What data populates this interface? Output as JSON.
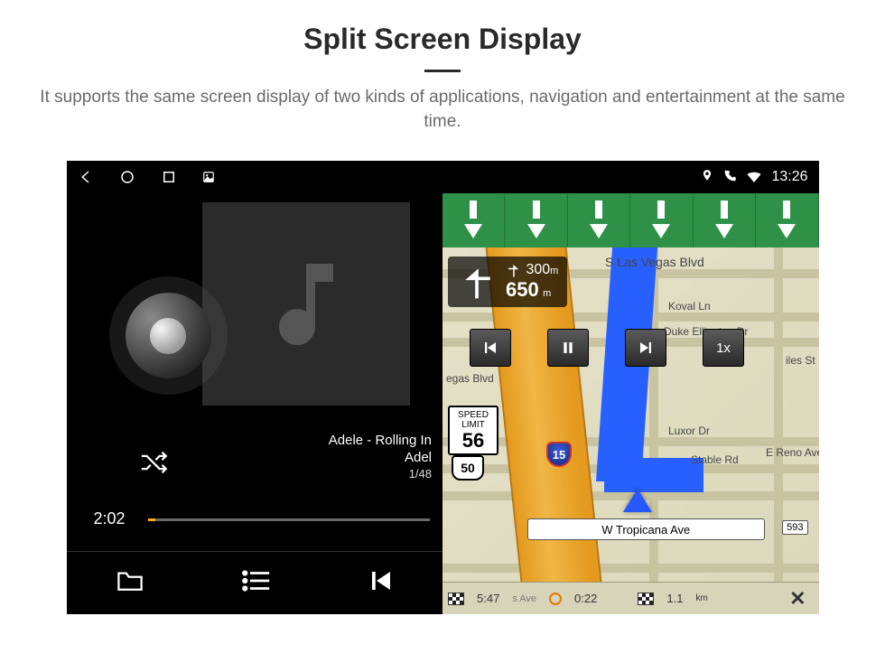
{
  "header": {
    "title": "Split Screen Display",
    "subtitle": "It supports the same screen display of two kinds of applications, navigation and entertainment at the same time."
  },
  "statusbar": {
    "time": "13:26"
  },
  "music": {
    "song_line1": "Adele - Rolling In",
    "song_line2": "Adel",
    "track_index": "1/48",
    "elapsed": "2:02"
  },
  "navigation": {
    "turn": {
      "primary_dist": "650",
      "primary_unit": "m",
      "secondary_dist": "300",
      "secondary_unit": "m"
    },
    "speed_limit": {
      "label1": "SPEED",
      "label2": "LIMIT",
      "value": "56"
    },
    "route_shield": "50",
    "interstate_shield": "15",
    "playback_speed": "1x",
    "streets": {
      "top": "S Las Vegas Blvd",
      "koval": "Koval Ln",
      "duke": "Duke Ellington Dr",
      "egas": "egas Blvd",
      "luxor": "Luxor Dr",
      "stable": "Stable Rd",
      "reno": "E Reno Ave",
      "giles": "iles St",
      "bottom": "W Tropicana Ave",
      "bottom_exit": "593",
      "footer_cross": "s Ave"
    },
    "footer": {
      "eta": "5:47",
      "duration": "0:22",
      "distance": "1.1",
      "distance_unit": "km"
    }
  }
}
